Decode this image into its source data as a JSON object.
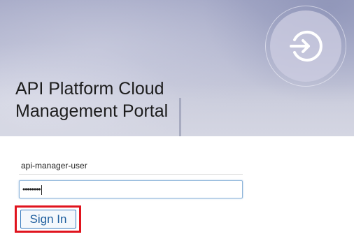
{
  "header": {
    "title_line1": "API Platform Cloud",
    "title_line2": "Management Portal",
    "login_icon": "sign-in-arrow-icon"
  },
  "form": {
    "username_value": "api-manager-user",
    "password_mask": "••••••••",
    "sign_in_label": "Sign In"
  },
  "colors": {
    "highlight": "#e0141e",
    "button_text": "#1f5f9e",
    "button_border": "#3b7dc0"
  }
}
